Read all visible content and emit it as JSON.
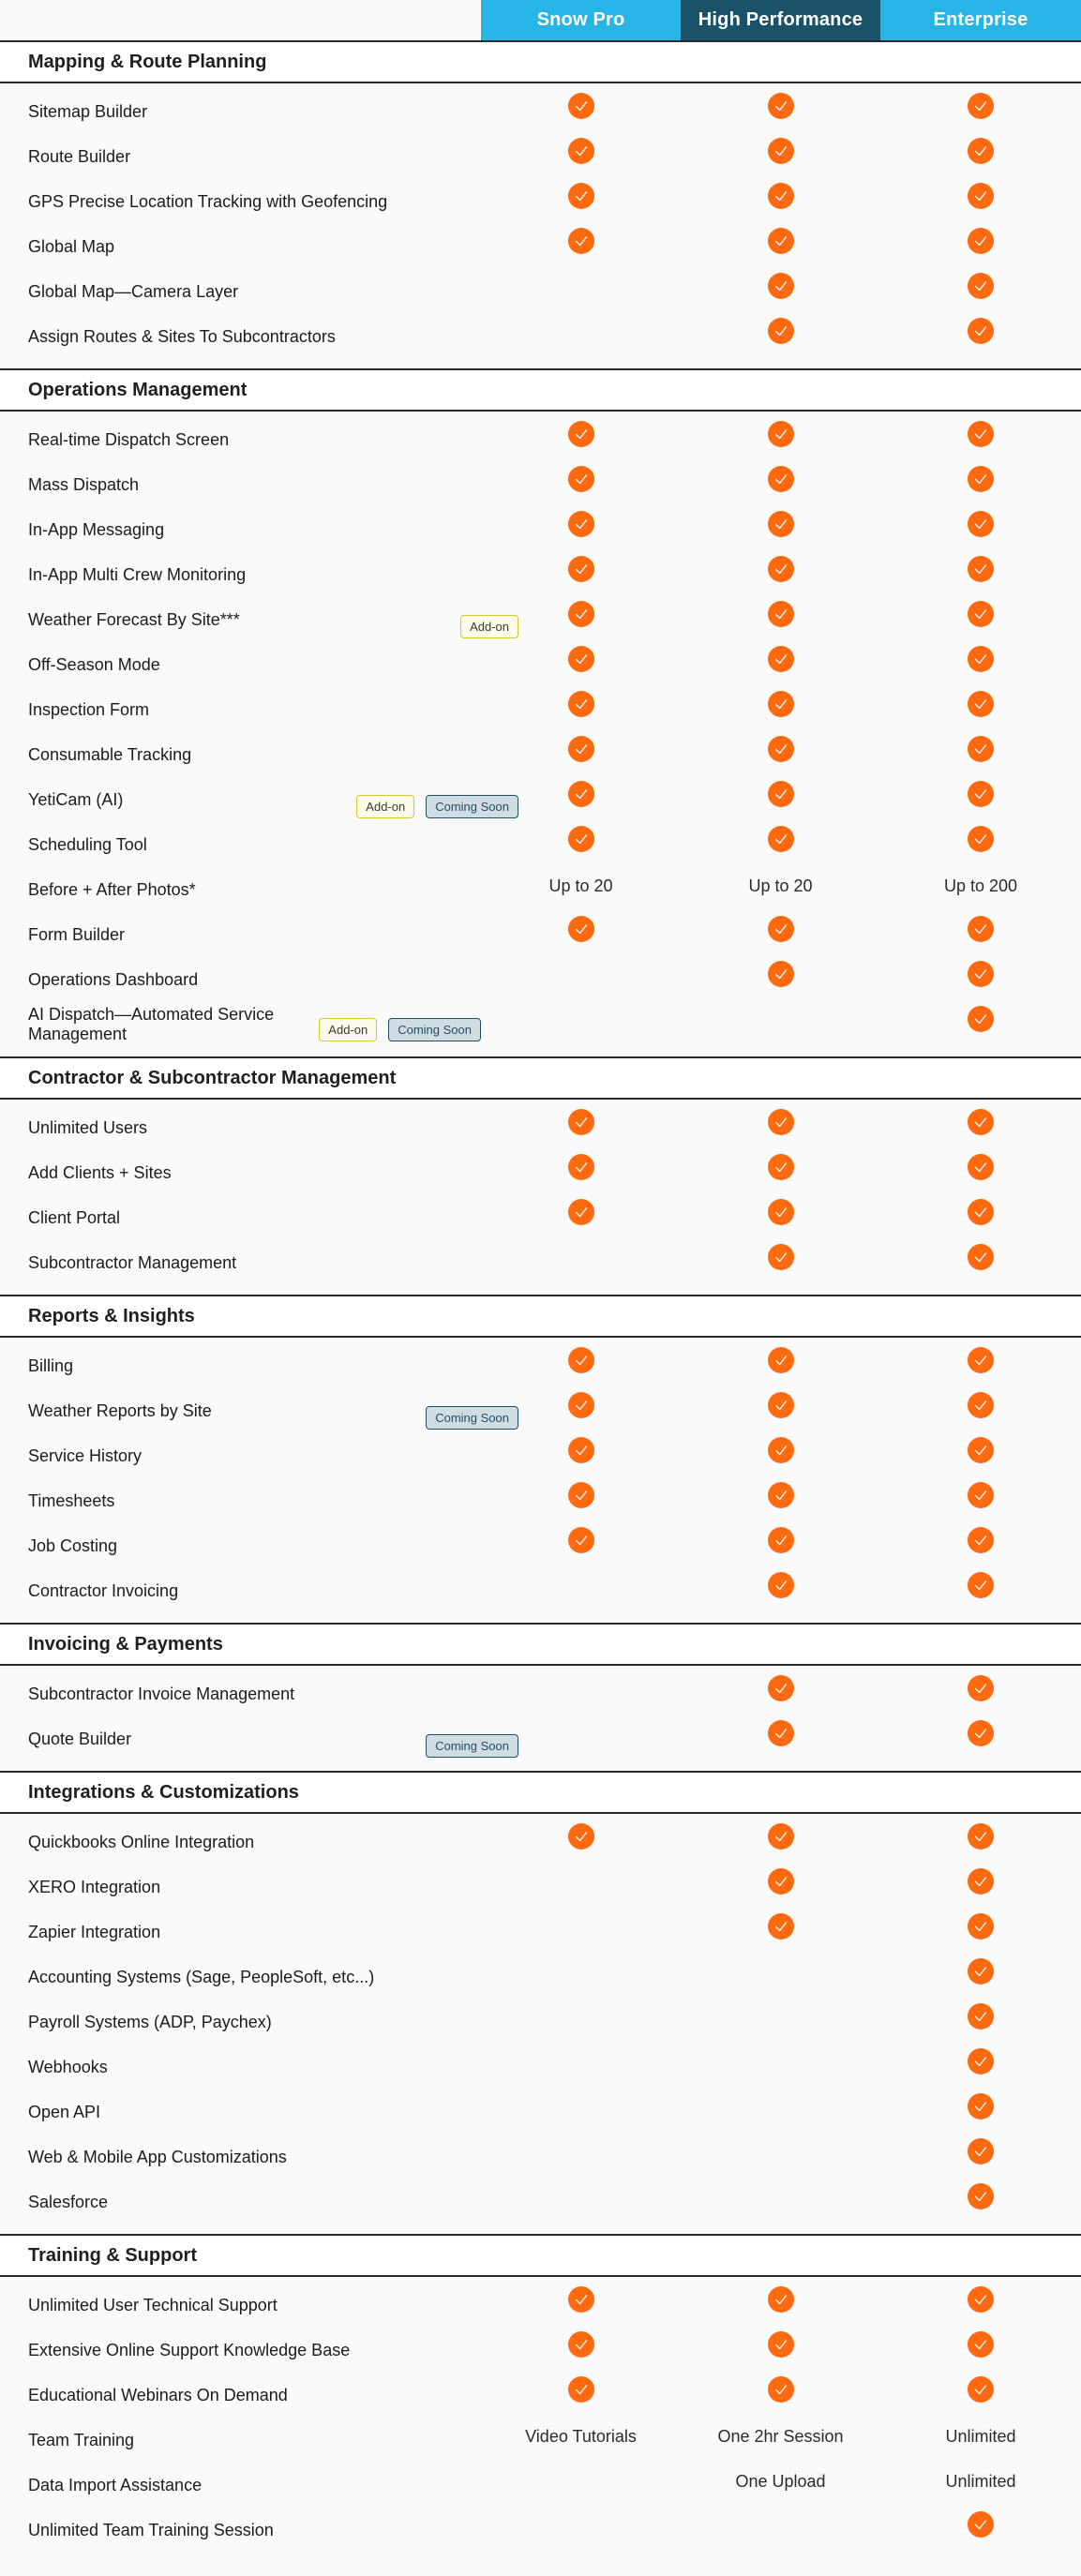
{
  "plans": [
    "Snow Pro",
    "High Performance",
    "Enterprise"
  ],
  "colors": {
    "plan_header": "#27b4e6",
    "plan_header_featured": "#1a5269",
    "check": "#ff6a10",
    "addon_badge_border": "#d6c62a",
    "coming_soon_badge_border": "#1e4f63"
  },
  "badge_labels": {
    "addon": "Add-on",
    "soon": "Coming Soon"
  },
  "sections": [
    {
      "title": "Mapping & Route Planning",
      "rows": [
        {
          "feature": "Sitemap Builder",
          "badges": [],
          "values": [
            "check",
            "check",
            "check"
          ]
        },
        {
          "feature": "Route Builder",
          "badges": [],
          "values": [
            "check",
            "check",
            "check"
          ]
        },
        {
          "feature": "GPS Precise Location Tracking with Geofencing",
          "badges": [],
          "values": [
            "check",
            "check",
            "check"
          ]
        },
        {
          "feature": "Global Map",
          "badges": [],
          "values": [
            "check",
            "check",
            "check"
          ]
        },
        {
          "feature": "Global Map—Camera Layer",
          "badges": [],
          "values": [
            "",
            "check",
            "check"
          ]
        },
        {
          "feature": "Assign Routes & Sites To Subcontractors",
          "badges": [],
          "values": [
            "",
            "check",
            "check"
          ]
        }
      ]
    },
    {
      "title": "Operations Management",
      "rows": [
        {
          "feature": "Real-time Dispatch Screen",
          "badges": [],
          "values": [
            "check",
            "check",
            "check"
          ]
        },
        {
          "feature": "Mass Dispatch",
          "badges": [],
          "values": [
            "check",
            "check",
            "check"
          ]
        },
        {
          "feature": "In-App Messaging",
          "badges": [],
          "values": [
            "check",
            "check",
            "check"
          ]
        },
        {
          "feature": "In-App Multi Crew Monitoring",
          "badges": [],
          "values": [
            "check",
            "check",
            "check"
          ]
        },
        {
          "feature": "Weather Forecast By Site***",
          "badges": [
            "Add-on"
          ],
          "values": [
            "check",
            "check",
            "check"
          ]
        },
        {
          "feature": "Off-Season Mode",
          "badges": [],
          "values": [
            "check",
            "check",
            "check"
          ]
        },
        {
          "feature": "Inspection Form",
          "badges": [],
          "values": [
            "check",
            "check",
            "check"
          ]
        },
        {
          "feature": "Consumable Tracking",
          "badges": [],
          "values": [
            "check",
            "check",
            "check"
          ]
        },
        {
          "feature": "YetiCam (AI)",
          "badges": [
            "Add-on",
            "Coming Soon"
          ],
          "values": [
            "check",
            "check",
            "check"
          ]
        },
        {
          "feature": "Scheduling Tool",
          "badges": [],
          "values": [
            "check",
            "check",
            "check"
          ]
        },
        {
          "feature": "Before + After Photos*",
          "badges": [],
          "values": [
            "Up to 20",
            "Up to 20",
            "Up to 200"
          ]
        },
        {
          "feature": "Form Builder",
          "badges": [],
          "values": [
            "check",
            "check",
            "check"
          ]
        },
        {
          "feature": "Operations Dashboard",
          "badges": [],
          "values": [
            "",
            "check",
            "check"
          ]
        },
        {
          "feature": "AI Dispatch—Automated Service Management",
          "badges": [
            "Add-on",
            "Coming Soon"
          ],
          "inline_badges": true,
          "values": [
            "",
            "",
            "check"
          ]
        }
      ]
    },
    {
      "title": "Contractor & Subcontractor Management",
      "rows": [
        {
          "feature": "Unlimited Users",
          "badges": [],
          "values": [
            "check",
            "check",
            "check"
          ]
        },
        {
          "feature": "Add Clients + Sites",
          "badges": [],
          "values": [
            "check",
            "check",
            "check"
          ]
        },
        {
          "feature": "Client Portal",
          "badges": [],
          "values": [
            "check",
            "check",
            "check"
          ]
        },
        {
          "feature": "Subcontractor Management",
          "badges": [],
          "values": [
            "",
            "check",
            "check"
          ]
        }
      ]
    },
    {
      "title": "Reports & Insights",
      "rows": [
        {
          "feature": "Billing",
          "badges": [],
          "values": [
            "check",
            "check",
            "check"
          ]
        },
        {
          "feature": "Weather Reports by Site",
          "badges": [
            "Coming Soon"
          ],
          "values": [
            "check",
            "check",
            "check"
          ]
        },
        {
          "feature": "Service History",
          "badges": [],
          "values": [
            "check",
            "check",
            "check"
          ]
        },
        {
          "feature": "Timesheets",
          "badges": [],
          "values": [
            "check",
            "check",
            "check"
          ]
        },
        {
          "feature": "Job Costing",
          "badges": [],
          "values": [
            "check",
            "check",
            "check"
          ]
        },
        {
          "feature": "Contractor Invoicing",
          "badges": [],
          "values": [
            "",
            "check",
            "check"
          ]
        }
      ]
    },
    {
      "title": "Invoicing & Payments",
      "rows": [
        {
          "feature": "Subcontractor Invoice Management",
          "badges": [],
          "values": [
            "",
            "check",
            "check"
          ]
        },
        {
          "feature": "Quote Builder",
          "badges": [
            "Coming Soon"
          ],
          "values": [
            "",
            "check",
            "check"
          ]
        }
      ]
    },
    {
      "title": "Integrations & Customizations",
      "rows": [
        {
          "feature": "Quickbooks Online Integration",
          "badges": [],
          "values": [
            "check",
            "check",
            "check"
          ]
        },
        {
          "feature": "XERO Integration",
          "badges": [],
          "values": [
            "",
            "check",
            "check"
          ]
        },
        {
          "feature": "Zapier Integration",
          "badges": [],
          "values": [
            "",
            "check",
            "check"
          ]
        },
        {
          "feature": "Accounting Systems (Sage, PeopleSoft, etc...)",
          "badges": [],
          "values": [
            "",
            "",
            "check"
          ]
        },
        {
          "feature": "Payroll Systems (ADP, Paychex)",
          "badges": [],
          "values": [
            "",
            "",
            "check"
          ]
        },
        {
          "feature": "Webhooks",
          "badges": [],
          "values": [
            "",
            "",
            "check"
          ]
        },
        {
          "feature": "Open API",
          "badges": [],
          "values": [
            "",
            "",
            "check"
          ]
        },
        {
          "feature": "Web & Mobile App Customizations",
          "badges": [],
          "values": [
            "",
            "",
            "check"
          ]
        },
        {
          "feature": "Salesforce",
          "badges": [],
          "values": [
            "",
            "",
            "check"
          ]
        }
      ]
    },
    {
      "title": "Training & Support",
      "rows": [
        {
          "feature": "Unlimited User Technical Support",
          "badges": [],
          "values": [
            "check",
            "check",
            "check"
          ]
        },
        {
          "feature": "Extensive Online Support Knowledge Base",
          "badges": [],
          "values": [
            "check",
            "check",
            "check"
          ]
        },
        {
          "feature": "Educational Webinars On Demand",
          "badges": [],
          "values": [
            "check",
            "check",
            "check"
          ]
        },
        {
          "feature": "Team Training",
          "badges": [],
          "values": [
            "Video Tutorials",
            "One 2hr Session",
            "Unlimited"
          ]
        },
        {
          "feature": "Data Import Assistance",
          "badges": [],
          "values": [
            "",
            "One Upload",
            "Unlimited"
          ]
        },
        {
          "feature": "Unlimited Team Training Session",
          "badges": [],
          "values": [
            "",
            "",
            "check"
          ]
        }
      ]
    }
  ]
}
